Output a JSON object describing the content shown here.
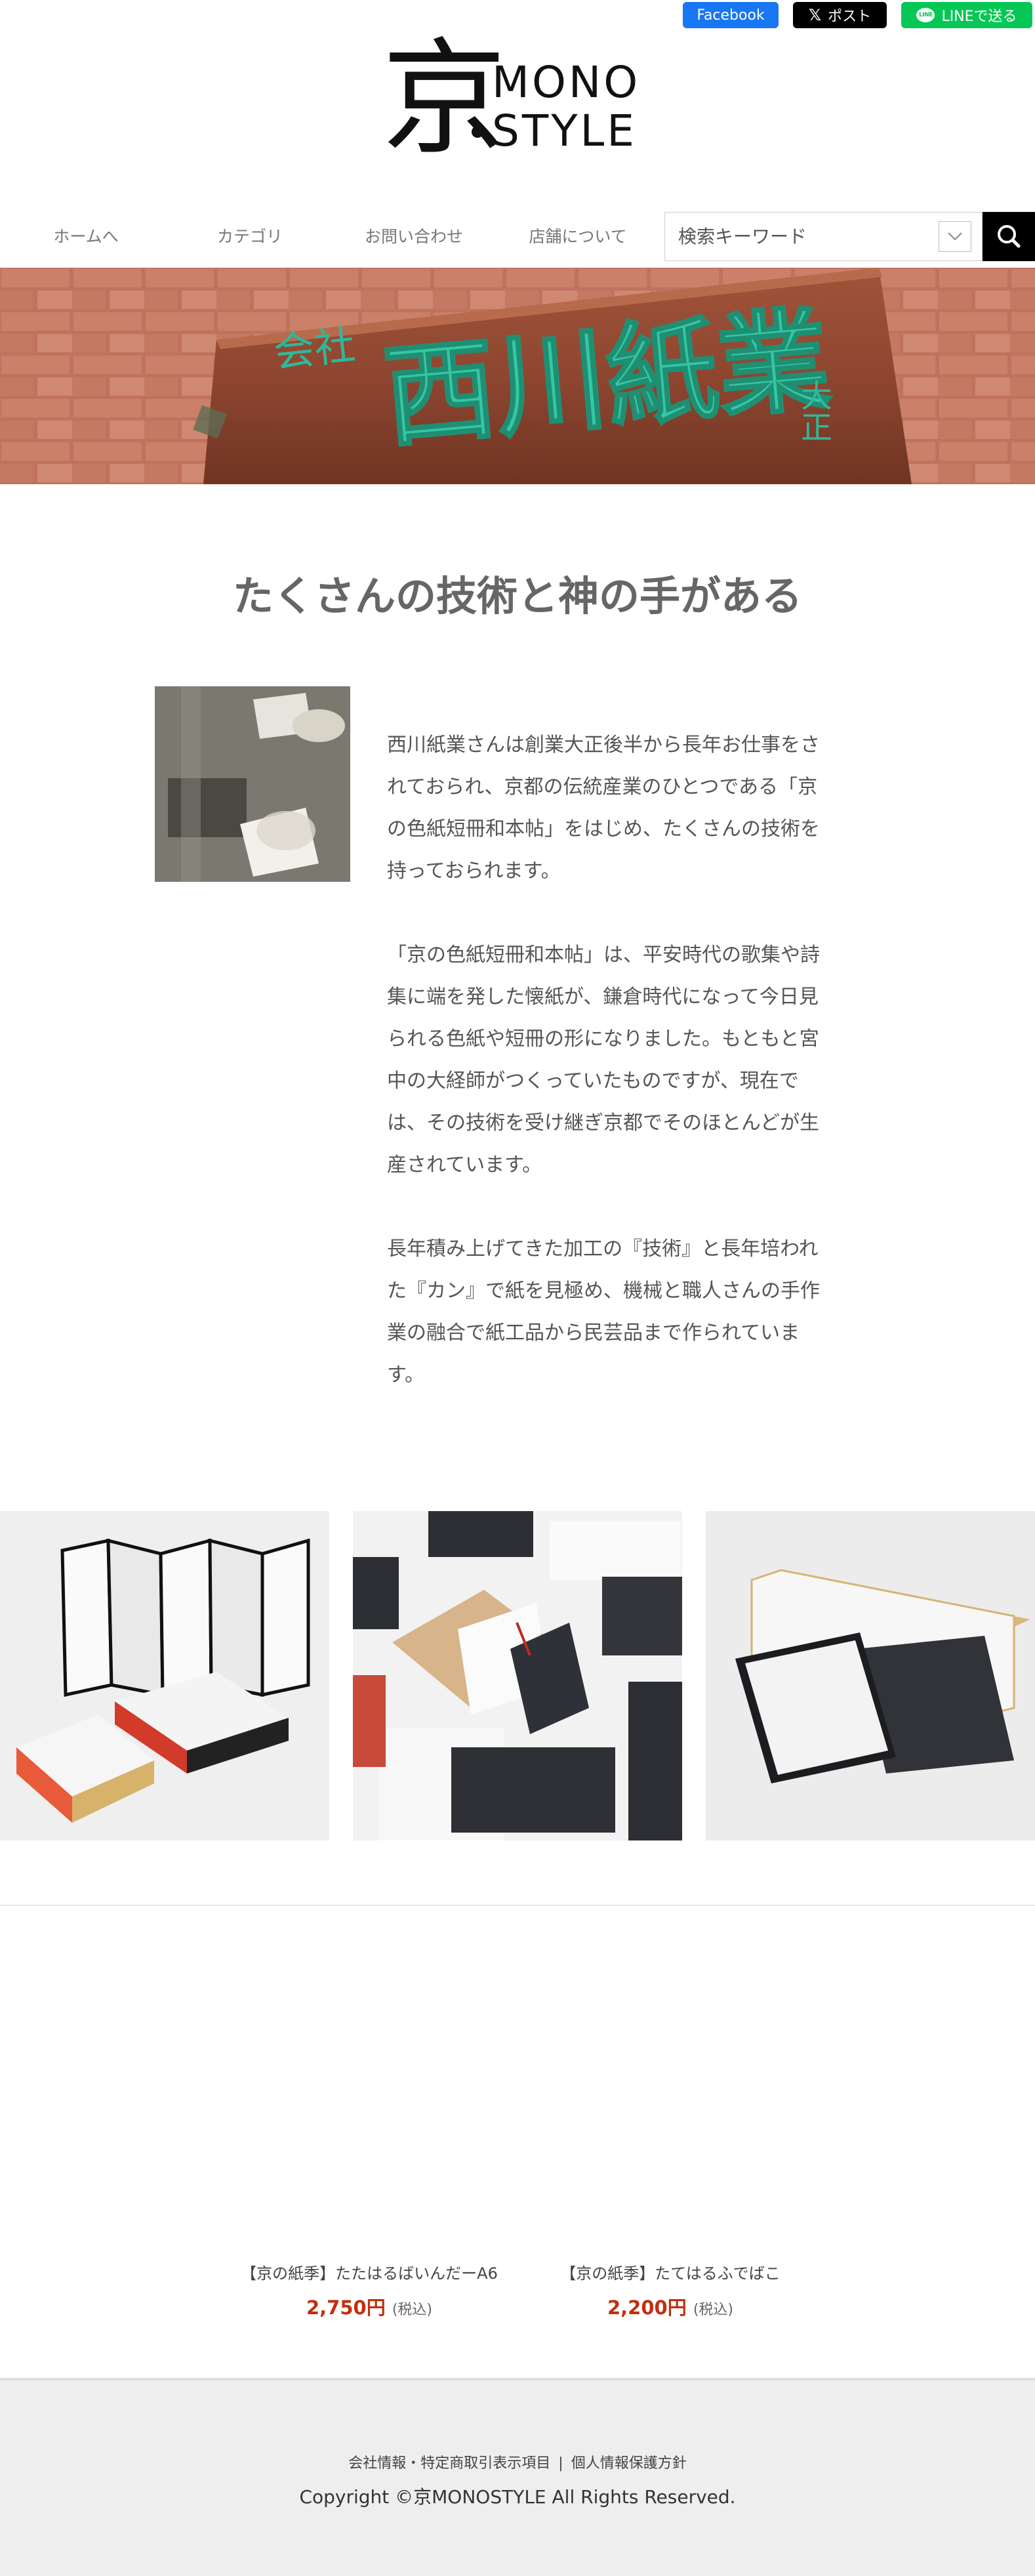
{
  "share": {
    "facebook_label": "Facebook",
    "x_label": "ポスト",
    "line_label": "LINEで送る",
    "line_bubble_text": "LINE",
    "colors": {
      "facebook": "#1877f2",
      "x": "#000000",
      "line": "#06c755"
    }
  },
  "logo": {
    "mark": "京",
    "line1": "MONO",
    "line2": "STYLE"
  },
  "nav": {
    "items": [
      {
        "label": "ホームへ"
      },
      {
        "label": "カテゴリ"
      },
      {
        "label": "お問い合わせ"
      },
      {
        "label": "店舗について"
      }
    ],
    "search_placeholder": "検索キーワード",
    "dropdown_icon": "chevron-down-icon",
    "search_icon": "search-icon"
  },
  "hero": {
    "sign_small": "会社",
    "sign_main": "西川紙業",
    "sign_side": "大正"
  },
  "headline": "たくさんの技術と神の手がある",
  "intro": {
    "paragraphs": [
      "西川紙業さんは創業大正後半から長年お仕事をされておられ、京都の伝統産業のひとつである「京の色紙短冊和本帖」をはじめ、たくさんの技術を持っておられます。",
      "「京の色紙短冊和本帖」は、平安時代の歌集や詩集に端を発した懐紙が、鎌倉時代になって今日見られる色紙や短冊の形になりました。もともと宮中の大経師がつくっていたものですが、現在では、その技術を受け継ぎ京都でそのほとんどが生産されています。",
      "長年積み上げてきた加工の『技術』と長年培われた『カン』で紙を見極め、機械と職人さんの手作業の融合で紙工品から民芸品まで作られています。"
    ]
  },
  "products": [
    {
      "name": "【京の紙季】たたはるばいんだーA6",
      "price": "2,750円",
      "tax": "(税込)"
    },
    {
      "name": "【京の紙季】たてはるふでばこ",
      "price": "2,200円",
      "tax": "(税込)"
    }
  ],
  "footer": {
    "link_company": "会社情報・特定商取引表示項目",
    "separator": "|",
    "link_privacy": "個人情報保護方針",
    "copyright": "Copyright ©京MONOSTYLE All Rights Reserved."
  },
  "colors": {
    "price": "#c0300f",
    "footer_bg": "#eeeeee"
  }
}
